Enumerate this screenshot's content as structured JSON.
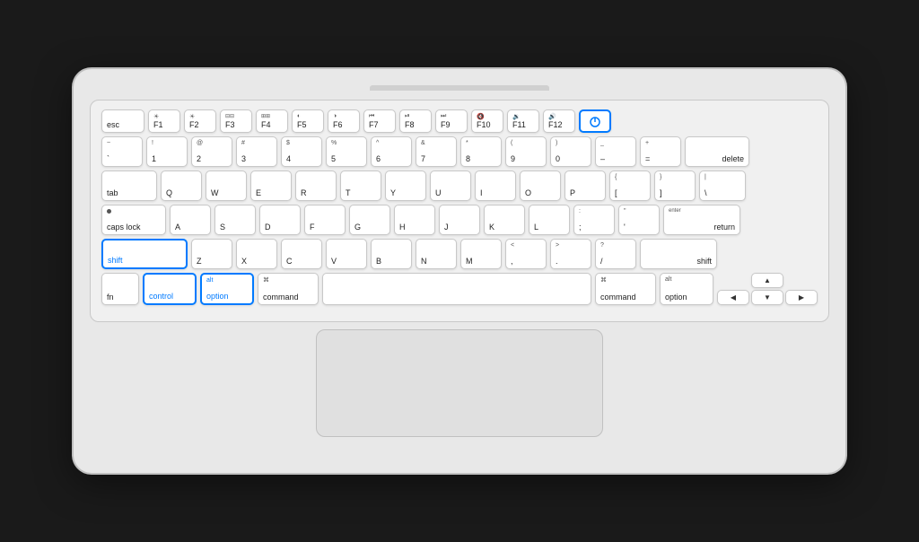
{
  "keyboard": {
    "rows": {
      "fn_row": {
        "keys": [
          {
            "id": "esc",
            "label": "esc",
            "width": "esc"
          },
          {
            "id": "f1",
            "top": "☀",
            "label": "F1",
            "width": "f1"
          },
          {
            "id": "f2",
            "top": "☀",
            "label": "F2",
            "width": "f2"
          },
          {
            "id": "f3",
            "top": "□□",
            "label": "F3",
            "width": "f3"
          },
          {
            "id": "f4",
            "top": "⊞",
            "label": "F4",
            "width": "f4"
          },
          {
            "id": "f5",
            "top": "🔆",
            "label": "F5",
            "width": "f5"
          },
          {
            "id": "f6",
            "top": "🔅",
            "label": "F6",
            "width": "f6"
          },
          {
            "id": "f7",
            "top": "◀◀",
            "label": "F7",
            "width": "f7"
          },
          {
            "id": "f8",
            "top": "▶||",
            "label": "F8",
            "width": "f8"
          },
          {
            "id": "f9",
            "top": "▶▶",
            "label": "F9",
            "width": "f9"
          },
          {
            "id": "f10",
            "top": "🔇",
            "label": "F10",
            "width": "f10"
          },
          {
            "id": "f11",
            "top": "🔉",
            "label": "F11",
            "width": "f11"
          },
          {
            "id": "f12",
            "top": "🔊",
            "label": "F12",
            "width": "f12"
          },
          {
            "id": "power",
            "label": "⏻",
            "width": "power",
            "highlighted": true
          }
        ]
      },
      "number_row": {
        "keys": [
          {
            "id": "tilde",
            "top": "~",
            "label": "`",
            "width": "std"
          },
          {
            "id": "1",
            "top": "!",
            "label": "1",
            "width": "std"
          },
          {
            "id": "2",
            "top": "@",
            "label": "2",
            "width": "std"
          },
          {
            "id": "3",
            "top": "#",
            "label": "3",
            "width": "std"
          },
          {
            "id": "4",
            "top": "$",
            "label": "4",
            "width": "std"
          },
          {
            "id": "5",
            "top": "%",
            "label": "5",
            "width": "std"
          },
          {
            "id": "6",
            "top": "^",
            "label": "6",
            "width": "std"
          },
          {
            "id": "7",
            "top": "&",
            "label": "7",
            "width": "std"
          },
          {
            "id": "8",
            "top": "*",
            "label": "8",
            "width": "std"
          },
          {
            "id": "9",
            "top": "(",
            "label": "9",
            "width": "std"
          },
          {
            "id": "0",
            "top": ")",
            "label": "0",
            "width": "std"
          },
          {
            "id": "minus",
            "top": "_",
            "label": "–",
            "width": "std"
          },
          {
            "id": "equals",
            "top": "+",
            "label": "=",
            "width": "std"
          },
          {
            "id": "delete",
            "label": "delete",
            "width": "delete"
          }
        ]
      },
      "qwerty_row": {
        "tab": "tab",
        "keys": [
          "Q",
          "W",
          "E",
          "R",
          "T",
          "Y",
          "U",
          "I",
          "O",
          "P"
        ],
        "end_keys": [
          {
            "id": "open-bracket",
            "top": "{",
            "label": "[",
            "width": "std"
          },
          {
            "id": "close-bracket",
            "top": "}",
            "label": "]",
            "width": "std"
          },
          {
            "id": "backslash",
            "top": "|",
            "label": "\\",
            "width": "backslash"
          }
        ]
      },
      "asdf_row": {
        "capslock": "caps lock",
        "keys": [
          "A",
          "S",
          "D",
          "F",
          "G",
          "H",
          "J",
          "K",
          "L"
        ],
        "end_keys": [
          {
            "id": "semicolon",
            "top": ":",
            "label": ";",
            "width": "std"
          },
          {
            "id": "quote",
            "top": "\"",
            "label": "'",
            "width": "std"
          }
        ],
        "return": "return"
      },
      "zxcv_row": {
        "shift_l": "shift",
        "keys": [
          "Z",
          "X",
          "C",
          "V",
          "B",
          "N",
          "M"
        ],
        "end_keys": [
          {
            "id": "comma",
            "top": "<",
            "label": ",",
            "width": "std"
          },
          {
            "id": "period",
            "top": ">",
            "label": ".",
            "width": "std"
          },
          {
            "id": "slash",
            "top": "?",
            "label": "/",
            "width": "std"
          }
        ],
        "shift_r": "shift"
      },
      "modifier_row": {
        "fn": "fn",
        "control": "control",
        "option_l_top": "alt",
        "option_l": "option",
        "command_l_sym": "⌘",
        "command_l": "command",
        "command_r_sym": "⌘",
        "command_r": "command",
        "option_r_top": "alt",
        "option_r": "option"
      }
    },
    "highlighted_keys": [
      "shift_l",
      "control",
      "option_l"
    ],
    "accent_color": "#007aff"
  }
}
